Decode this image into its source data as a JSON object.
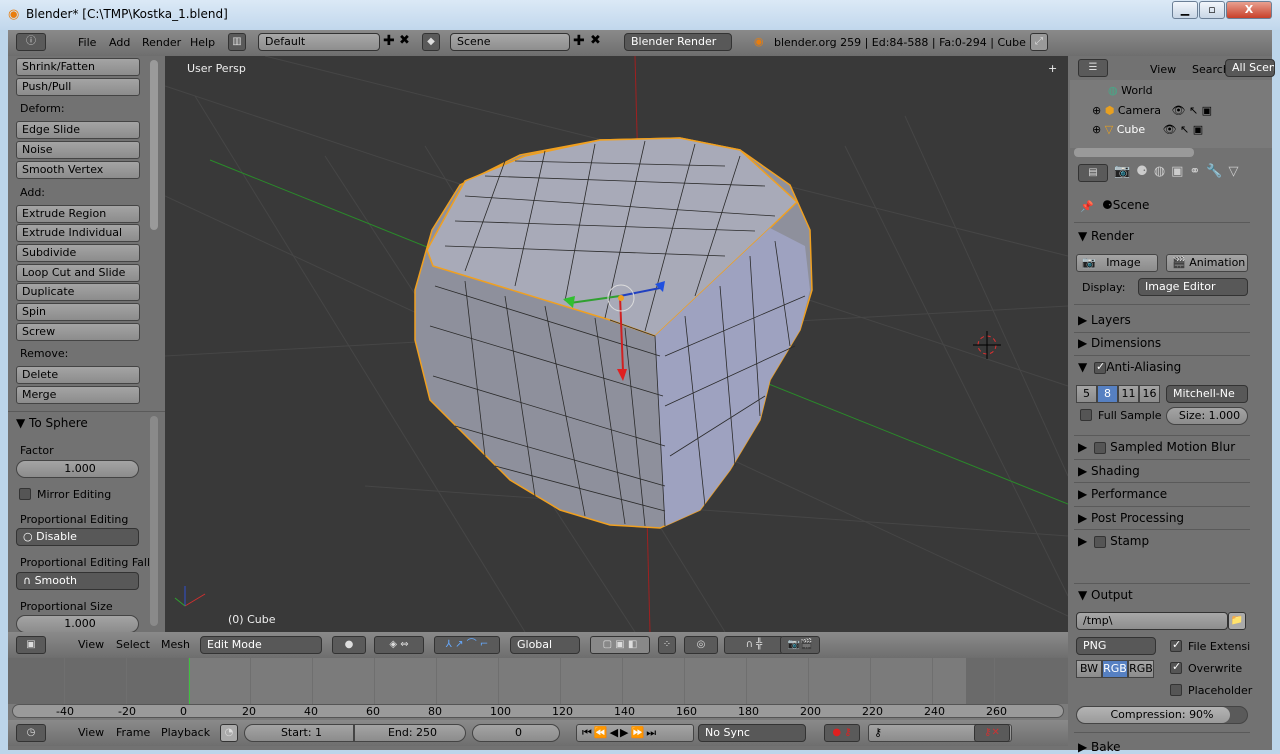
{
  "window": {
    "title": "Blender* [C:\\TMP\\Kostka_1.blend]",
    "minimize": "▁",
    "maximize": "▫",
    "close": "X"
  },
  "topbar": {
    "menus": [
      "File",
      "Add",
      "Render",
      "Help"
    ],
    "layout": "Default",
    "scene": "Scene",
    "engine": "Blender Render",
    "info": "blender.org 259 | Ed:84-588 | Fa:0-294 | Cube"
  },
  "toolshelf": {
    "items": [
      {
        "type": "button",
        "label": "Shrink/Fatten"
      },
      {
        "type": "button",
        "label": "Push/Pull"
      },
      {
        "type": "label",
        "label": "Deform:"
      },
      {
        "type": "button",
        "label": "Edge Slide"
      },
      {
        "type": "button",
        "label": "Noise"
      },
      {
        "type": "button",
        "label": "Smooth Vertex"
      },
      {
        "type": "label",
        "label": "Add:"
      },
      {
        "type": "button",
        "label": "Extrude Region"
      },
      {
        "type": "button",
        "label": "Extrude Individual"
      },
      {
        "type": "button",
        "label": "Subdivide"
      },
      {
        "type": "button",
        "label": "Loop Cut and Slide"
      },
      {
        "type": "button",
        "label": "Duplicate"
      },
      {
        "type": "button",
        "label": "Spin"
      },
      {
        "type": "button",
        "label": "Screw"
      },
      {
        "type": "label",
        "label": "Remove:"
      },
      {
        "type": "button",
        "label": "Delete"
      },
      {
        "type": "button",
        "label": "Merge"
      }
    ],
    "operator": {
      "title": "To Sphere",
      "factor_label": "Factor",
      "factor": "1.000",
      "mirror_label": "Mirror Editing",
      "mirror": false,
      "prop_label": "Proportional Editing",
      "prop_value": "Disable",
      "falloff_label": "Proportional Editing Fall",
      "falloff_value": "Smooth",
      "size_label": "Proportional Size",
      "size_value": "1.000"
    }
  },
  "viewport": {
    "view_name": "User Persp",
    "object_label": "(0) Cube",
    "colors": {
      "background": "#393939",
      "mesh": "#9c9eac",
      "selection": "#f0a020",
      "x_axis": "#b02020",
      "y_axis": "#2a8a2a"
    }
  },
  "header3d": {
    "menus": [
      "View",
      "Select",
      "Mesh"
    ],
    "mode": "Edit Mode",
    "orientation": "Global"
  },
  "timeline": {
    "ticks": [
      "-40",
      "-20",
      "0",
      "20",
      "40",
      "60",
      "80",
      "100",
      "120",
      "140",
      "160",
      "180",
      "200",
      "220",
      "240",
      "260"
    ],
    "current_frame_marker": "0",
    "menus": [
      "View",
      "Frame",
      "Playback"
    ],
    "start": "Start: 1",
    "end": "End: 250",
    "frame": "0",
    "sync": "No Sync"
  },
  "outliner": {
    "menus": [
      "View",
      "Search"
    ],
    "filter": "All Scenes",
    "items": [
      "World",
      "Camera",
      "Cube"
    ]
  },
  "properties": {
    "context": "Scene",
    "render": {
      "title": "Render",
      "image": "Image",
      "animation": "Animation",
      "display_label": "Display:",
      "display": "Image Editor"
    },
    "panels_closed_1": [
      "Layers",
      "Dimensions"
    ],
    "aa": {
      "title": "Anti-Aliasing",
      "enabled": true,
      "samples": [
        "5",
        "8",
        "11",
        "16"
      ],
      "selected": "8",
      "filter": "Mitchell-Ne",
      "full_sample": "Full Sample",
      "size": "Size: 1.000"
    },
    "panels_closed_2": [
      {
        "label": "Sampled Motion Blur",
        "checkbox": true
      },
      {
        "label": "Shading"
      },
      {
        "label": "Performance"
      },
      {
        "label": "Post Processing"
      },
      {
        "label": "Stamp",
        "checkbox": true
      }
    ],
    "output": {
      "title": "Output",
      "path": "/tmp\\",
      "format": "PNG",
      "file_ext": "File Extensi",
      "color_modes": [
        "BW",
        "RGB",
        "RGB"
      ],
      "selected_mode": "RGB",
      "overwrite": "Overwrite",
      "placeholder": "Placeholder",
      "compression": "Compression: 90%",
      "compression_value": 90
    },
    "bake": "Bake"
  }
}
